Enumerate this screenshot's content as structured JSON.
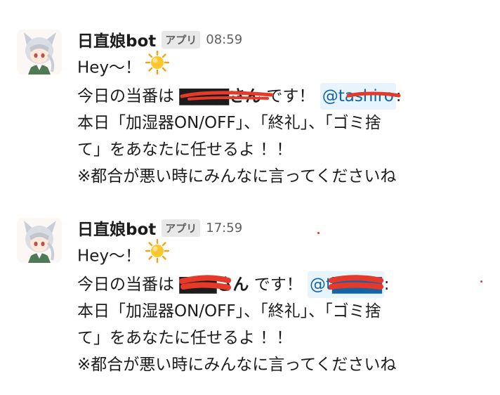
{
  "messages": [
    {
      "sender": "日直娘bot",
      "badge": "アプリ",
      "time": "08:59",
      "greeting": "Hey〜！",
      "duty_prefix": "今日の当番は",
      "duty_name": "▇▇▇▇さん",
      "duty_suffix": "です！",
      "mention": "@tashiro",
      "mention_colon": ":",
      "tasks_line1": "本日「加湿器ON/OFF」、「終礼」、「ゴミ捨",
      "tasks_line2": "て」をあなたに任せるよ ！！",
      "notice": "※都合が悪い時にみんなに言ってくださいね"
    },
    {
      "sender": "日直娘bot",
      "badge": "アプリ",
      "time": "17:59",
      "greeting": "Hey〜！",
      "duty_prefix": "今日の当番は",
      "duty_name": "▇▇▇さん",
      "duty_suffix": "です！",
      "mention": "@t▇▇▇▇",
      "mention_colon": ":",
      "tasks_line1": "本日「加湿器ON/OFF」、「終礼」、「ゴミ捨",
      "tasks_line2": "て」をあなたに任せるよ ！！",
      "notice": "※都合が悪い時にみんなに言ってくださいね"
    }
  ],
  "icons": {
    "avatar": "anime-girl-avatar",
    "sun": "sun-emoji"
  },
  "colors": {
    "mention_bg": "#e8f4fb",
    "mention_text": "#1264a3",
    "redaction": "#e53a2a",
    "badge_bg": "#e8e8e8"
  }
}
